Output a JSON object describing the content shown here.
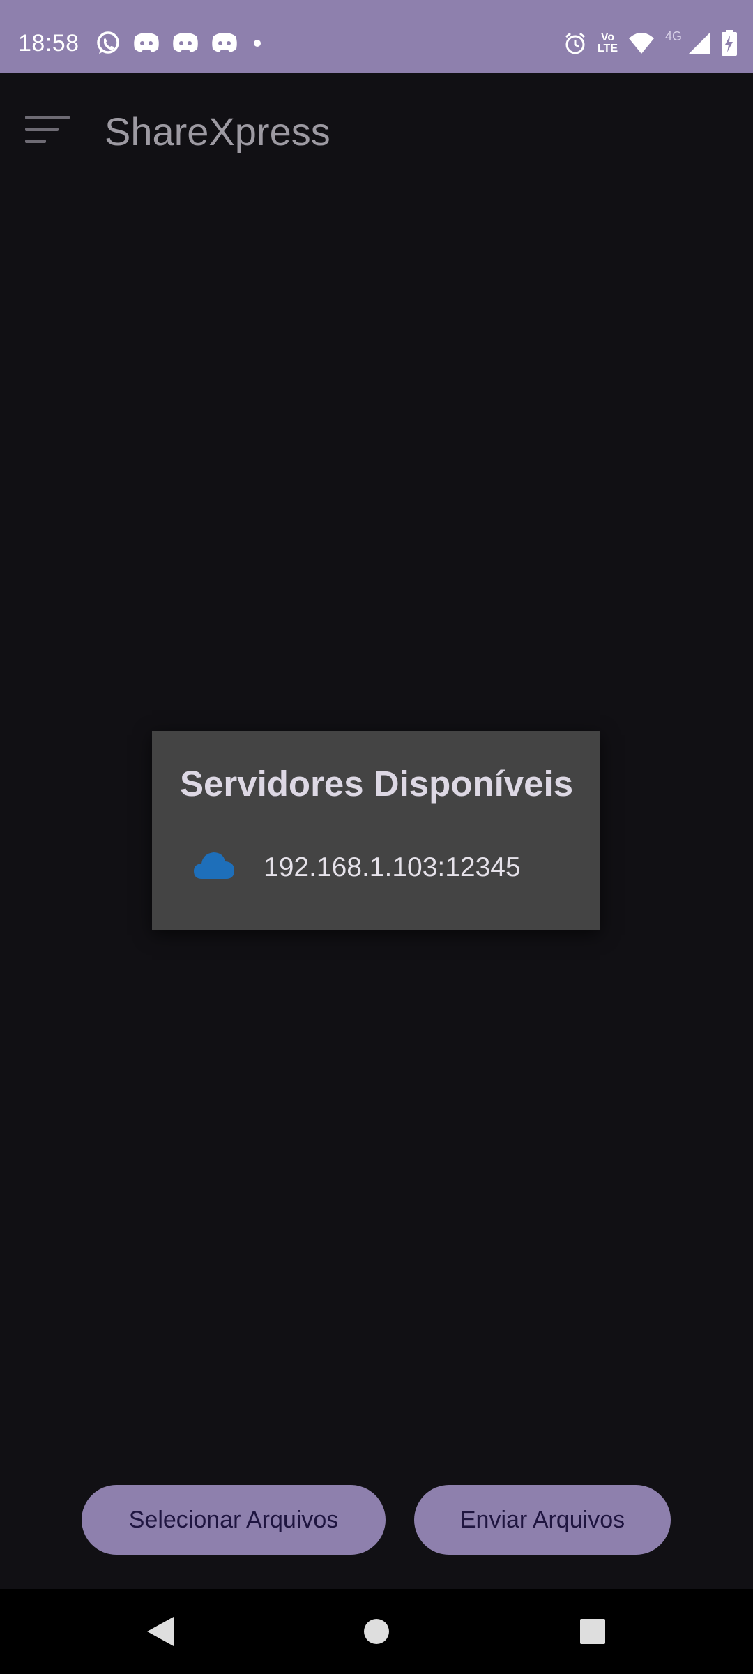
{
  "status_bar": {
    "time": "18:58",
    "notification_icons": [
      "whatsapp-icon",
      "discord-icon",
      "discord-icon",
      "discord-icon",
      "dot-icon"
    ],
    "system_icons": [
      "alarm-icon",
      "volte-icon",
      "wifi-icon",
      "4g-icon",
      "signal-icon",
      "battery-charging-icon"
    ],
    "volte_top": "Vo",
    "volte_bottom": "LTE",
    "network_label": "4G",
    "color": "#8e80ad"
  },
  "app_bar": {
    "title": "ShareXpress",
    "menu_icon": "menu-icon"
  },
  "dialog": {
    "title": "Servidores Disponíveis",
    "servers": [
      {
        "icon": "cloud-icon",
        "address": "192.168.1.103:12345",
        "icon_color": "#1e6fba"
      }
    ]
  },
  "actions": {
    "select_label": "Selecionar Arquivos",
    "send_label": "Enviar Arquivos",
    "button_color": "#8e80ad"
  },
  "nav_bar": {
    "buttons": [
      "back-icon",
      "home-icon",
      "recents-icon"
    ]
  }
}
